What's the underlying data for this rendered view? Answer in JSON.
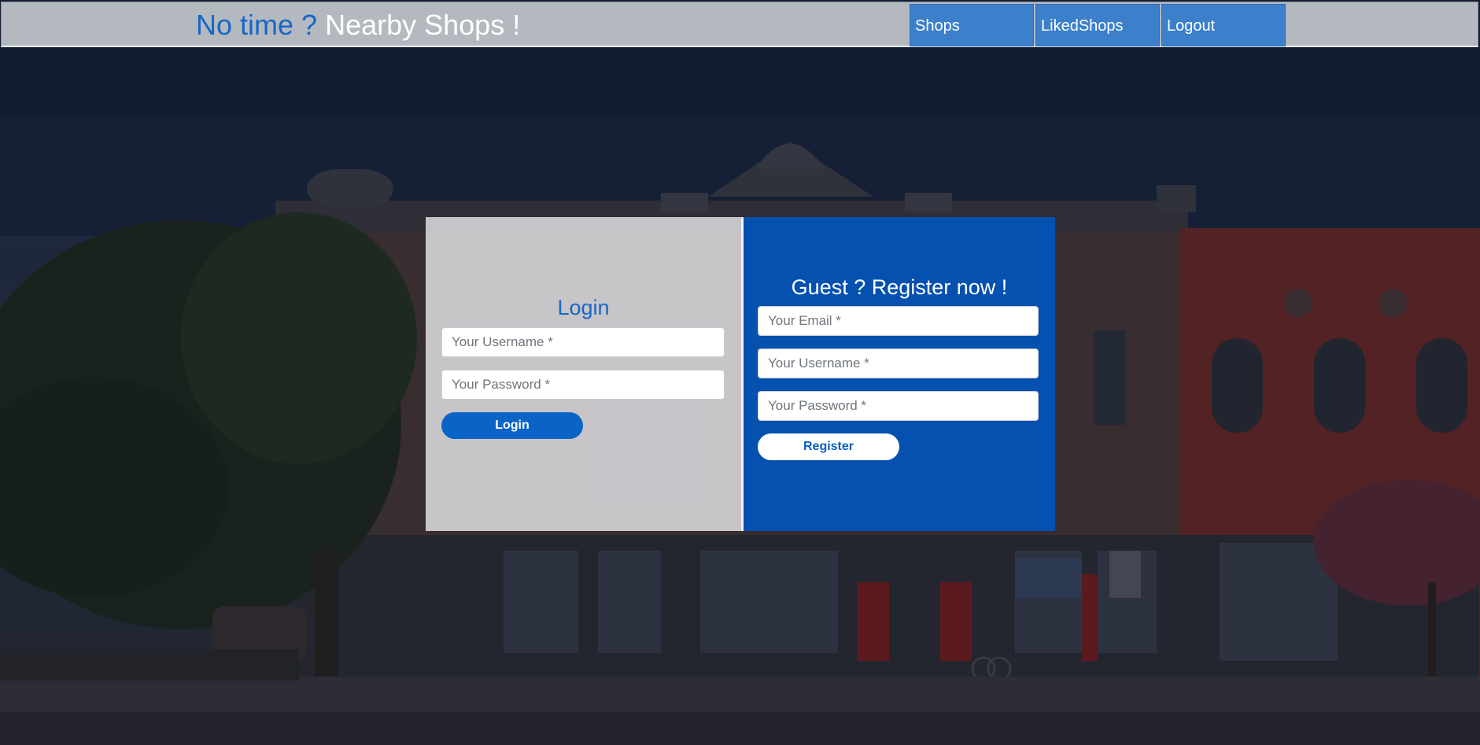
{
  "header": {
    "brand_prefix": "No time ?",
    "brand_suffix": "Nearby Shops !",
    "nav": [
      {
        "label": "Shops"
      },
      {
        "label": "LikedShops"
      },
      {
        "label": "Logout"
      }
    ]
  },
  "login": {
    "title": "Login",
    "username_placeholder": "Your Username *",
    "password_placeholder": "Your Password *",
    "button_label": "Login"
  },
  "register": {
    "title": "Guest ? Register now !",
    "email_placeholder": "Your Email *",
    "username_placeholder": "Your Username *",
    "password_placeholder": "Your Password *",
    "button_label": "Register"
  },
  "colors": {
    "navbar_bg": "#b4b9c0",
    "nav_item_bg": "#3c80cb",
    "brand_blue": "#1766c7",
    "register_panel": "#0055be",
    "login_panel": "#dedee2"
  }
}
